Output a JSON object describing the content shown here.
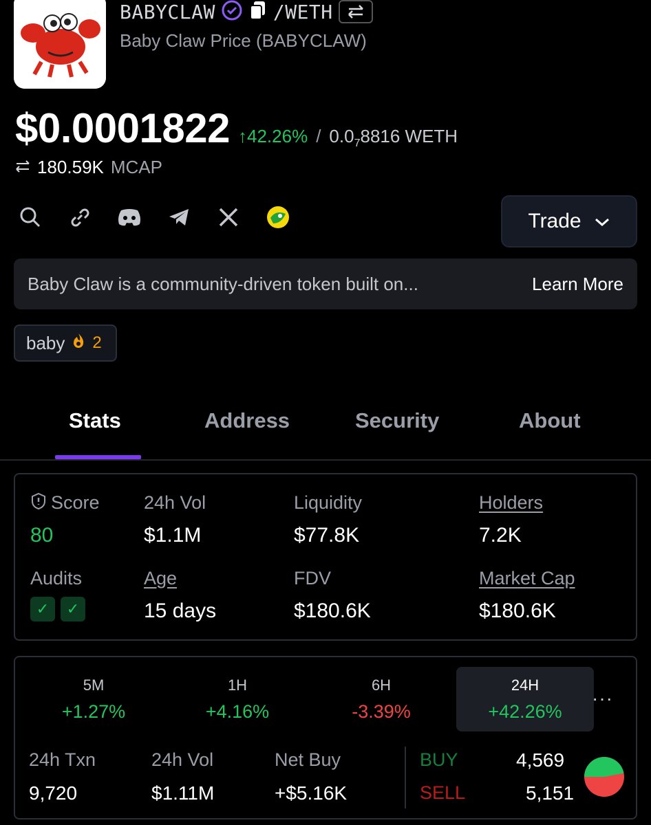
{
  "header": {
    "symbol": "BABYCLAW",
    "quote": "/WETH",
    "full_name": "Baby Claw Price (BABYCLAW)"
  },
  "price": {
    "usd": "$0.0001822",
    "change": "42.26%",
    "weth_prefix": "0.0",
    "weth_zeros": "7",
    "weth_rest": "8816 WETH",
    "mcap_value": "180.59K",
    "mcap_label": "MCAP"
  },
  "links": {
    "trade_label": "Trade"
  },
  "description": {
    "text": "Baby Claw is a community-driven token built on...",
    "learn_more": "Learn More"
  },
  "tag": {
    "label": "baby",
    "count": "2"
  },
  "tabs": [
    "Stats",
    "Address",
    "Security",
    "About"
  ],
  "stats": {
    "score_label": "Score",
    "score_value": "80",
    "vol_label": "24h Vol",
    "vol_value": "$1.1M",
    "liq_label": "Liquidity",
    "liq_value": "$77.8K",
    "holders_label": "Holders",
    "holders_value": "7.2K",
    "audits_label": "Audits",
    "age_label": "Age",
    "age_value": "15 days",
    "fdv_label": "FDV",
    "fdv_value": "$180.6K",
    "mcap_label": "Market Cap",
    "mcap_value": "$180.6K"
  },
  "timeframes": [
    {
      "name": "5M",
      "change": "+1.27%",
      "dir": "up"
    },
    {
      "name": "1H",
      "change": "+4.16%",
      "dir": "up"
    },
    {
      "name": "6H",
      "change": "-3.39%",
      "dir": "down"
    },
    {
      "name": "24H",
      "change": "+42.26%",
      "dir": "up"
    }
  ],
  "more_label": "···",
  "txn": {
    "txn_label": "24h Txn",
    "txn_value": "9,720",
    "vol_label": "24h Vol",
    "vol_value": "$1.11M",
    "net_label": "Net Buy",
    "net_value": "+$5.16K",
    "buy_label": "BUY",
    "buy_value": "4,569",
    "sell_label": "SELL",
    "sell_value": "5,151",
    "buy_fraction": 0.47
  },
  "colors": {
    "accent": "#7c3aed",
    "up": "#22c55e",
    "down": "#ef4444"
  }
}
